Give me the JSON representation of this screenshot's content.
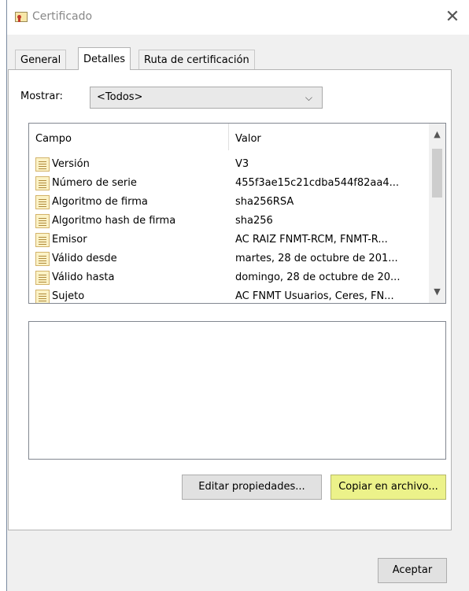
{
  "window": {
    "title": "Certificado",
    "close_glyph": "✕"
  },
  "tabs": [
    {
      "label": "General"
    },
    {
      "label": "Detalles"
    },
    {
      "label": "Ruta de certificación"
    }
  ],
  "active_tab": "Detalles",
  "show": {
    "label": "Mostrar:",
    "value": "<Todos>"
  },
  "list": {
    "columns": {
      "field": "Campo",
      "value": "Valor"
    },
    "rows": [
      {
        "field": "Versión",
        "value": "V3"
      },
      {
        "field": "Número de serie",
        "value": "455f3ae15c21cdba544f82aa4..."
      },
      {
        "field": "Algoritmo de firma",
        "value": "sha256RSA"
      },
      {
        "field": "Algoritmo hash de firma",
        "value": "sha256"
      },
      {
        "field": "Emisor",
        "value": "AC RAIZ FNMT-RCM, FNMT-R..."
      },
      {
        "field": "Válido desde",
        "value": "martes, 28 de octubre de 201..."
      },
      {
        "field": "Válido hasta",
        "value": "domingo, 28 de octubre de 20..."
      },
      {
        "field": "Sujeto",
        "value": "AC FNMT Usuarios, Ceres, FN..."
      }
    ]
  },
  "buttons": {
    "edit": "Editar propiedades...",
    "copy": "Copiar en archivo...",
    "ok": "Aceptar"
  },
  "icons": {
    "title": "certificate-icon",
    "row": "field-icon",
    "scroll_up": "▲",
    "scroll_down": "▼",
    "chevron": "⌵"
  },
  "colors": {
    "highlight_button": "#ecf28a"
  }
}
